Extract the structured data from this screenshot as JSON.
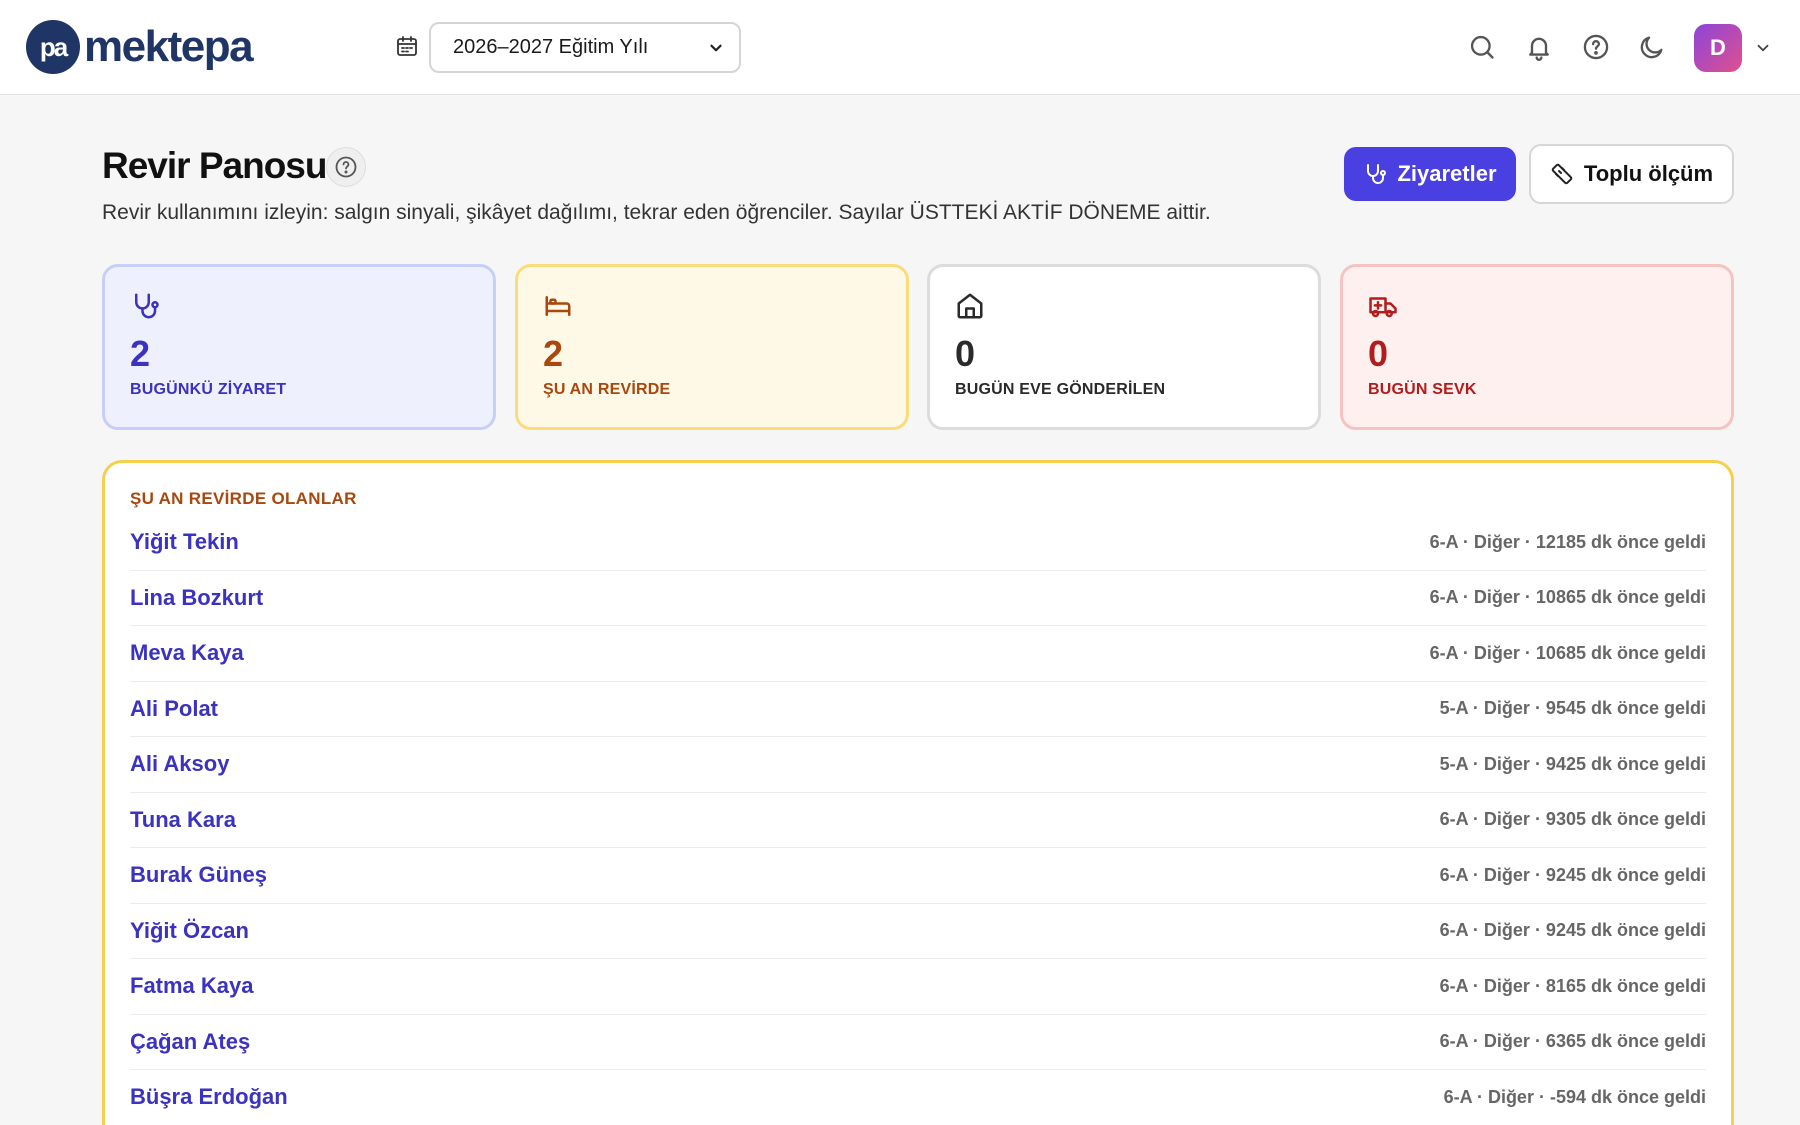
{
  "brand": {
    "logo_mark": "pa",
    "name": "mektepa"
  },
  "header": {
    "year_select": {
      "value": "2026–2027 Eğitim Yılı"
    },
    "icons": [
      "calendar-icon",
      "search-icon",
      "bell-icon",
      "help-icon",
      "moon-icon"
    ],
    "avatar_initial": "D"
  },
  "page": {
    "title": "Revir Panosu",
    "subtitle": "Revir kullanımını izleyin: salgın sinyali, şikâyet dağılımı, tekrar eden öğrenciler. Sayılar ÜSTTEKİ AKTİF DÖNEME aittir.",
    "primary_button": "Ziyaretler",
    "secondary_button": "Toplu ölçüm"
  },
  "stats": [
    {
      "icon": "stethoscope-icon",
      "value": "2",
      "label": "BUGÜNKÜ ZİYARET"
    },
    {
      "icon": "bed-icon",
      "value": "2",
      "label": "ŞU AN REVİRDE"
    },
    {
      "icon": "home-icon",
      "value": "0",
      "label": "BUGÜN EVE GÖNDERİLEN"
    },
    {
      "icon": "ambulance-icon",
      "value": "0",
      "label": "BUGÜN SEVK"
    }
  ],
  "in_clinic": {
    "title": "ŞU AN REVİRDE OLANLAR",
    "rows": [
      {
        "name": "Yiğit Tekin",
        "meta": "6-A · Diğer · 12185 dk önce geldi"
      },
      {
        "name": "Lina Bozkurt",
        "meta": "6-A · Diğer · 10865 dk önce geldi"
      },
      {
        "name": "Meva Kaya",
        "meta": "6-A · Diğer · 10685 dk önce geldi"
      },
      {
        "name": "Ali Polat",
        "meta": "5-A · Diğer · 9545 dk önce geldi"
      },
      {
        "name": "Ali Aksoy",
        "meta": "5-A · Diğer · 9425 dk önce geldi"
      },
      {
        "name": "Tuna Kara",
        "meta": "6-A · Diğer · 9305 dk önce geldi"
      },
      {
        "name": "Burak Güneş",
        "meta": "6-A · Diğer · 9245 dk önce geldi"
      },
      {
        "name": "Yiğit Özcan",
        "meta": "6-A · Diğer · 9245 dk önce geldi"
      },
      {
        "name": "Fatma Kaya",
        "meta": "6-A · Diğer · 8165 dk önce geldi"
      },
      {
        "name": "Çağan Ateş",
        "meta": "6-A · Diğer · 6365 dk önce geldi"
      },
      {
        "name": "Büşra Erdoğan",
        "meta": "6-A · Diğer · -594 dk önce geldi"
      }
    ]
  }
}
